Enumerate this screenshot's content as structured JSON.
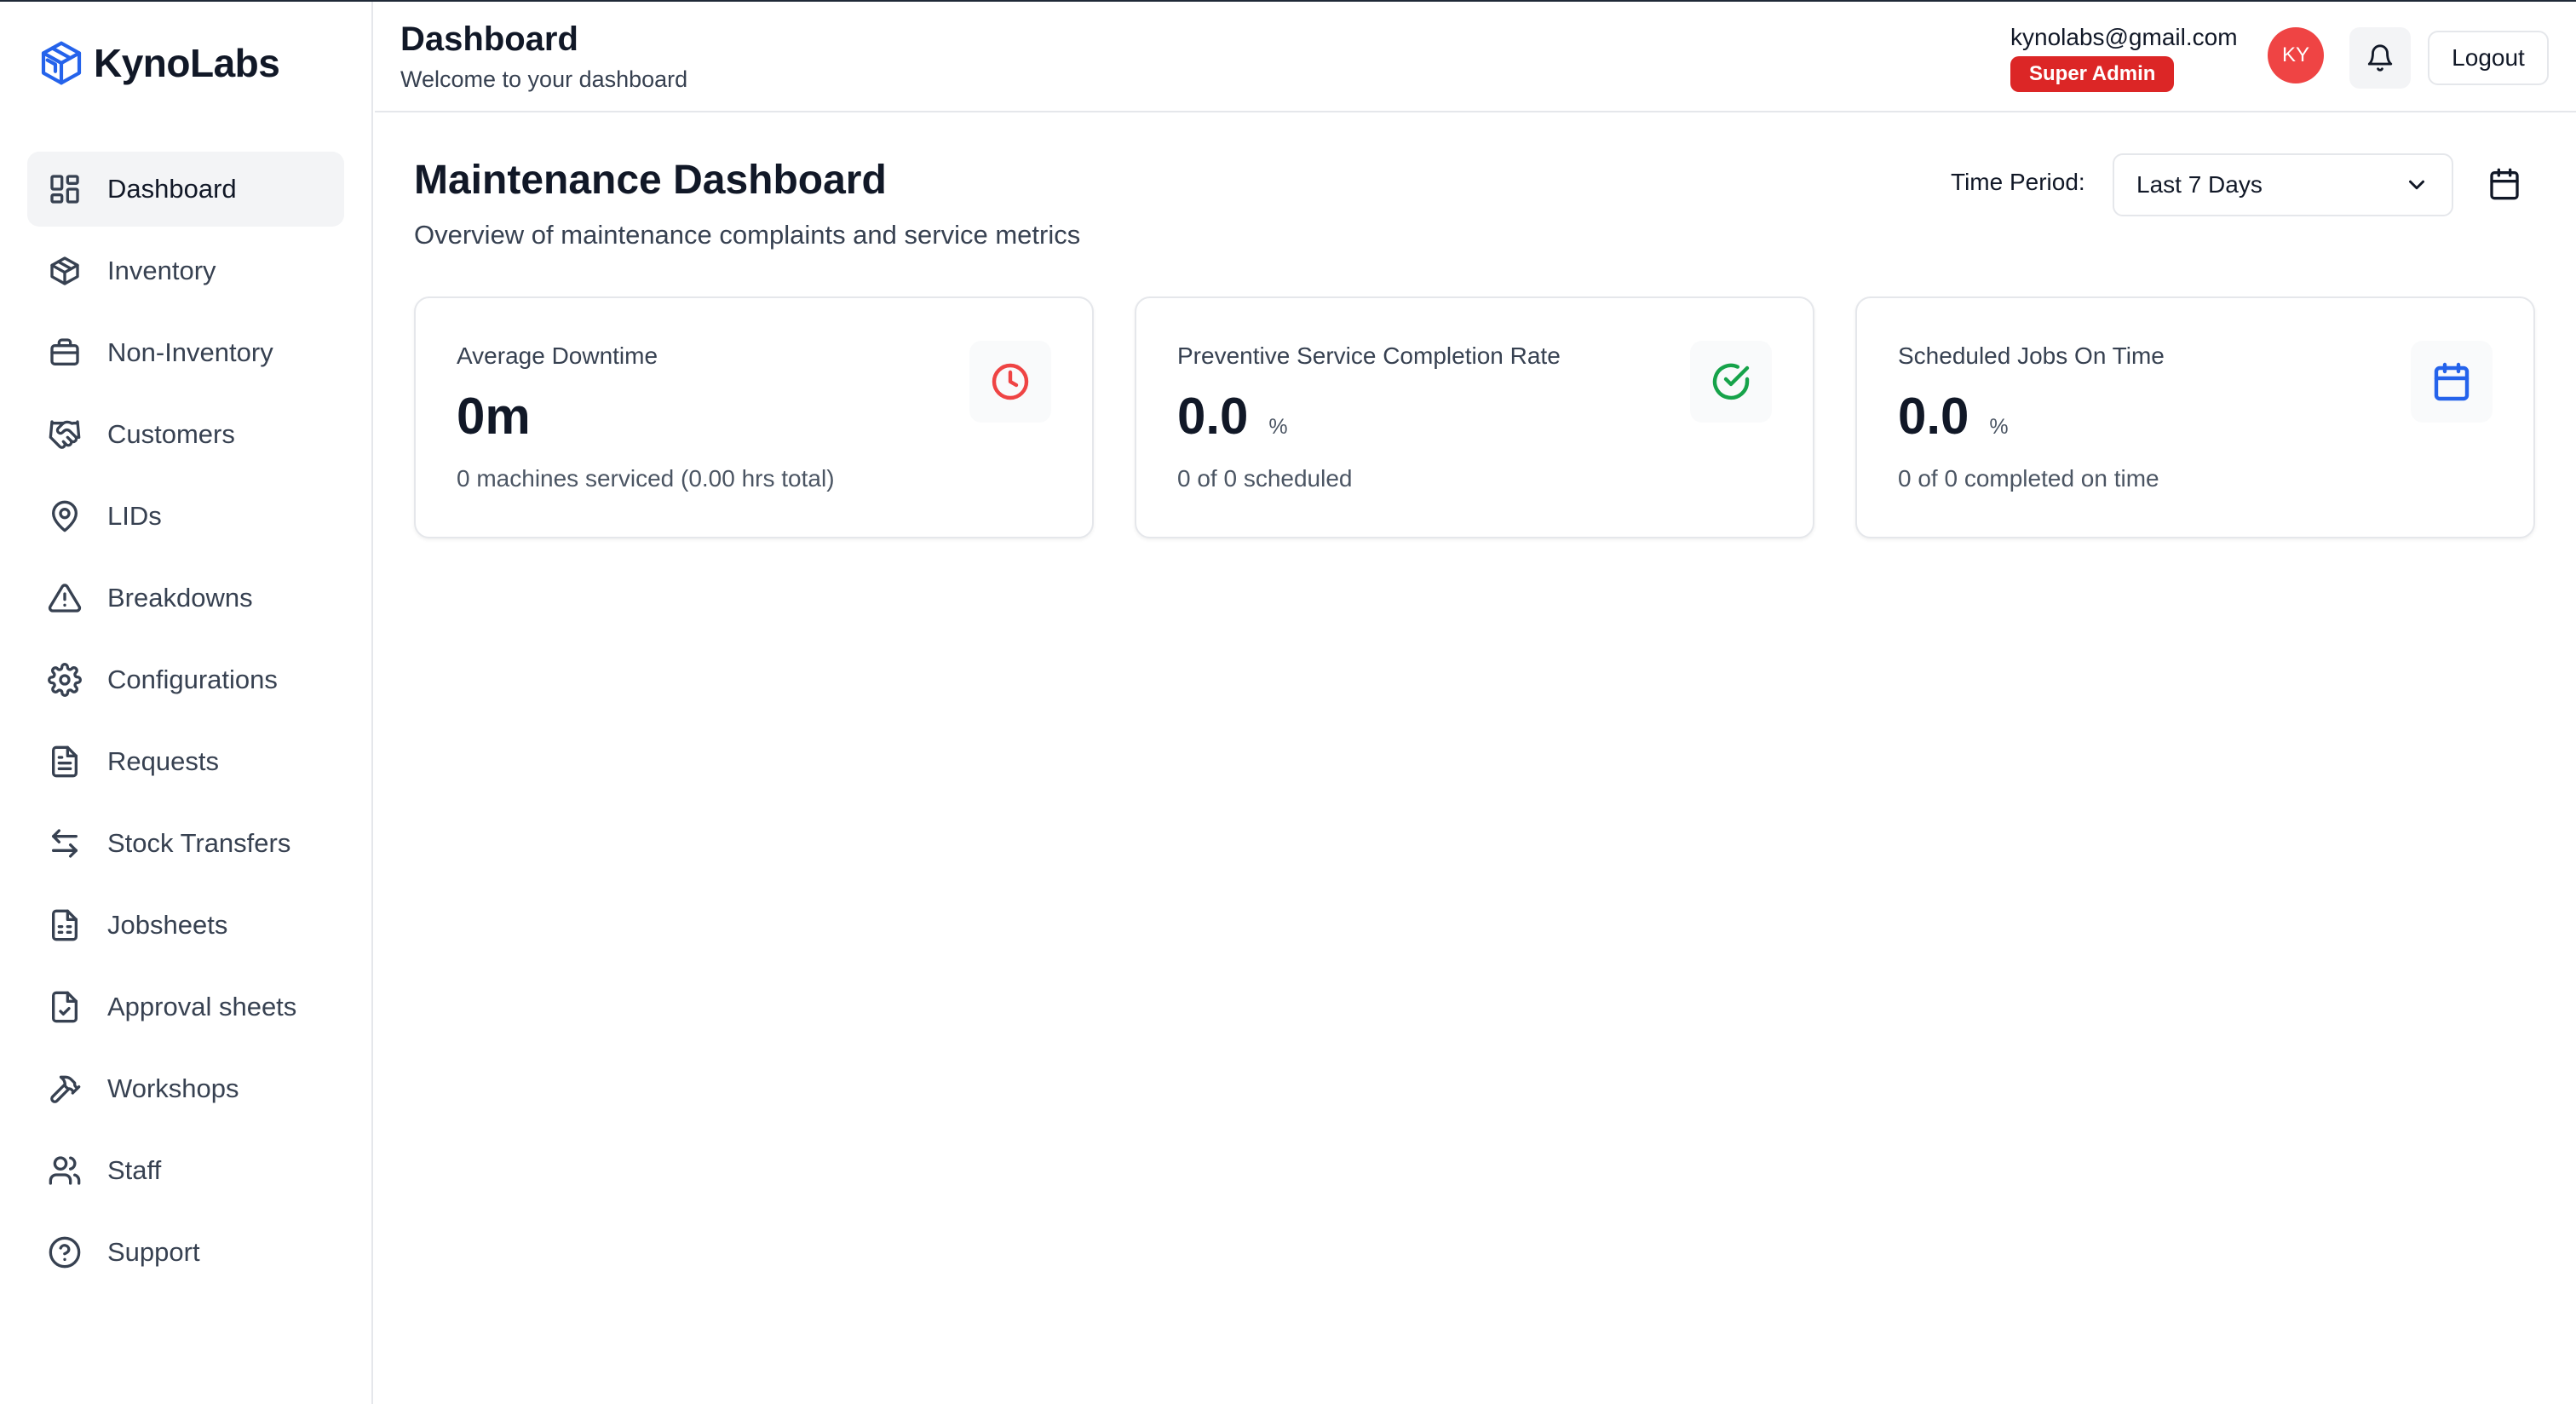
{
  "brand": {
    "name": "KynoLabs",
    "logo_icon": "box-logo-icon",
    "color": "#2563eb"
  },
  "sidebar": {
    "items": [
      {
        "label": "Dashboard",
        "icon": "layout-grid-icon",
        "active": true
      },
      {
        "label": "Inventory",
        "icon": "package-icon"
      },
      {
        "label": "Non-Inventory",
        "icon": "briefcase-icon"
      },
      {
        "label": "Customers",
        "icon": "handshake-icon"
      },
      {
        "label": "LIDs",
        "icon": "map-pin-icon"
      },
      {
        "label": "Breakdowns",
        "icon": "alert-triangle-icon"
      },
      {
        "label": "Configurations",
        "icon": "gear-icon"
      },
      {
        "label": "Requests",
        "icon": "file-text-icon"
      },
      {
        "label": "Stock Transfers",
        "icon": "arrows-left-right-icon"
      },
      {
        "label": "Jobsheets",
        "icon": "file-spreadsheet-icon"
      },
      {
        "label": "Approval sheets",
        "icon": "file-check-icon"
      },
      {
        "label": "Workshops",
        "icon": "hammer-icon"
      },
      {
        "label": "Staff",
        "icon": "users-icon"
      },
      {
        "label": "Support",
        "icon": "help-circle-icon"
      }
    ]
  },
  "header": {
    "title": "Dashboard",
    "subtitle": "Welcome to your dashboard",
    "user_email": "kynolabs@gmail.com",
    "role": "Super Admin",
    "role_color": "#dc2626",
    "avatar_initials": "KY",
    "avatar_color": "#ef4444",
    "bell_icon": "bell-icon",
    "logout_label": "Logout"
  },
  "main": {
    "title": "Maintenance Dashboard",
    "subtitle": "Overview of maintenance complaints and service metrics",
    "time_period_label": "Time Period:",
    "time_period_value": "Last 7 Days",
    "calendar_icon": "calendar-icon"
  },
  "cards": [
    {
      "label": "Average Downtime",
      "value": "0m",
      "unit": "",
      "footnote": "0 machines serviced (0.00 hrs total)",
      "icon": "clock-icon",
      "icon_color": "#ef4444"
    },
    {
      "label": "Preventive Service Completion Rate",
      "value": "0.0",
      "unit": "%",
      "footnote": "0 of 0 scheduled",
      "icon": "check-circle-icon",
      "icon_color": "#16a34a"
    },
    {
      "label": "Scheduled Jobs On Time",
      "value": "0.0",
      "unit": "%",
      "footnote": "0 of 0 completed on time",
      "icon": "calendar-icon",
      "icon_color": "#2563eb"
    }
  ]
}
